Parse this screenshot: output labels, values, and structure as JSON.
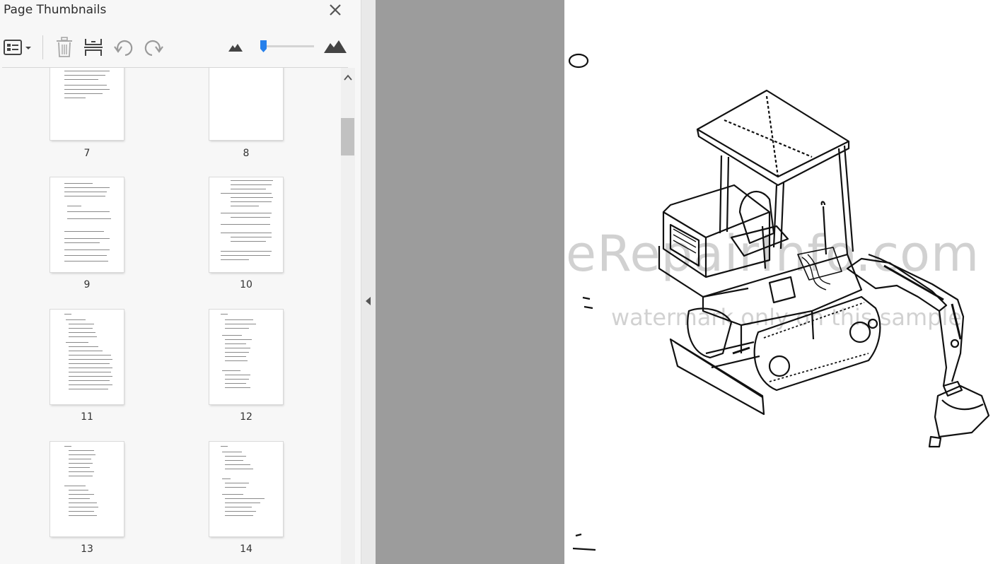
{
  "panel": {
    "title": "Page Thumbnails",
    "icons": {
      "close": "close-icon",
      "options": "thumbnail-options-icon",
      "delete": "trash-icon",
      "insert": "insert-pages-icon",
      "undo": "rotate-counterclockwise-icon",
      "redo": "rotate-clockwise-icon",
      "zoom_out": "small-mountain-icon",
      "zoom_in": "large-mountain-icon"
    },
    "thumbnail_size_level": 0.05
  },
  "thumbnails": [
    {
      "label": "7"
    },
    {
      "label": "8"
    },
    {
      "label": "9"
    },
    {
      "label": "10"
    },
    {
      "label": "11"
    },
    {
      "label": "12"
    },
    {
      "label": "13"
    },
    {
      "label": "14"
    }
  ],
  "document": {
    "watermark_main": "eRepairInfo.com",
    "watermark_sub": "watermark only on this sample"
  },
  "colors": {
    "panel_bg": "#f7f7f7",
    "canvas_gray": "#9c9c9c",
    "accent_blue": "#2680eb"
  }
}
